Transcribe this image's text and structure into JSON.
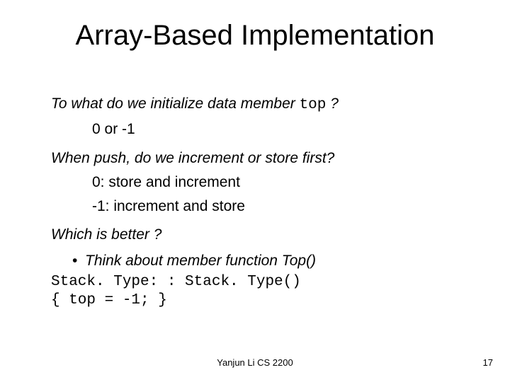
{
  "title": "Array-Based Implementation",
  "q1_prefix": "To what do we initialize data member ",
  "q1_code": "top",
  "q1_suffix": "  ?",
  "a1": "0 or -1",
  "q2": "When push, do we increment or store first?",
  "a2a": "0: store and increment",
  "a2b": "-1: increment and store",
  "q3": "Which is better ?",
  "bullet_dot": "•",
  "bullet_text": "Think about member function Top()",
  "code_line1": "Stack. Type: : Stack. Type()",
  "code_line2": "{ top = -1; }",
  "footer_center": "Yanjun Li CS 2200",
  "footer_right": "17"
}
